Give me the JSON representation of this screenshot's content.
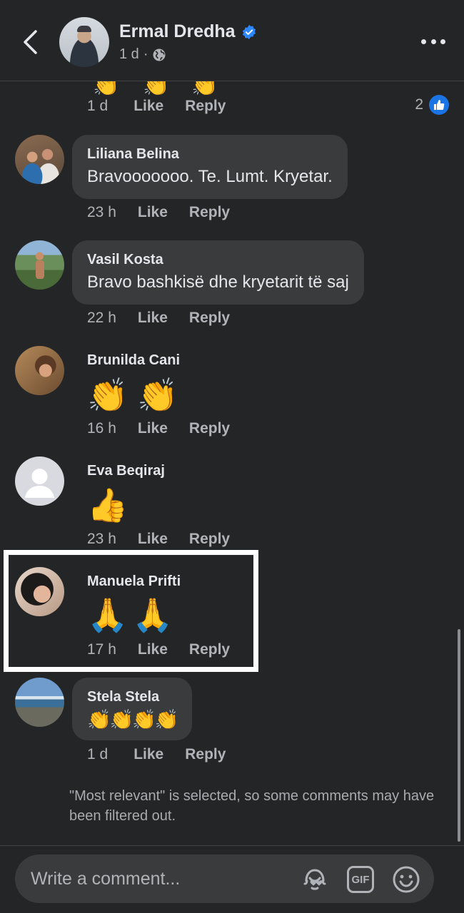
{
  "header": {
    "name": "Ermal Dredha",
    "time": "1 d",
    "separator": "·"
  },
  "top_comment": {
    "time": "1 d",
    "like": "Like",
    "reply": "Reply",
    "reaction_count": "2",
    "partial_emoji": "👏"
  },
  "comments": [
    {
      "author": "Liliana Belina",
      "text": "Bravooooooo.  Te. Lumt. Kryetar.",
      "time": "23 h",
      "like": "Like",
      "reply": "Reply"
    },
    {
      "author": "Vasil Kosta",
      "text": "Bravo bashkisë dhe kryetarit të saj",
      "time": "22 h",
      "like": "Like",
      "reply": "Reply"
    },
    {
      "author": "Brunilda Cani",
      "text": "👏 👏",
      "time": "16 h",
      "like": "Like",
      "reply": "Reply"
    },
    {
      "author": "Eva Beqiraj",
      "text": "👍",
      "time": "23 h",
      "like": "Like",
      "reply": "Reply"
    },
    {
      "author": "Manuela Prifti",
      "text": "🙏🙏",
      "time": "17 h",
      "like": "Like",
      "reply": "Reply"
    },
    {
      "author": "Stela Stela",
      "text": "👏👏👏👏",
      "time": "1 d",
      "like": "Like",
      "reply": "Reply"
    }
  ],
  "filter_note": "\"Most relevant\" is selected, so some comments may have been filtered out.",
  "composer": {
    "placeholder": "Write a comment...",
    "gif_label": "GIF"
  },
  "colors": {
    "background": "#242526",
    "bubble": "#3a3b3c",
    "accent": "#1b74e4",
    "verified": "#2d88ff"
  }
}
